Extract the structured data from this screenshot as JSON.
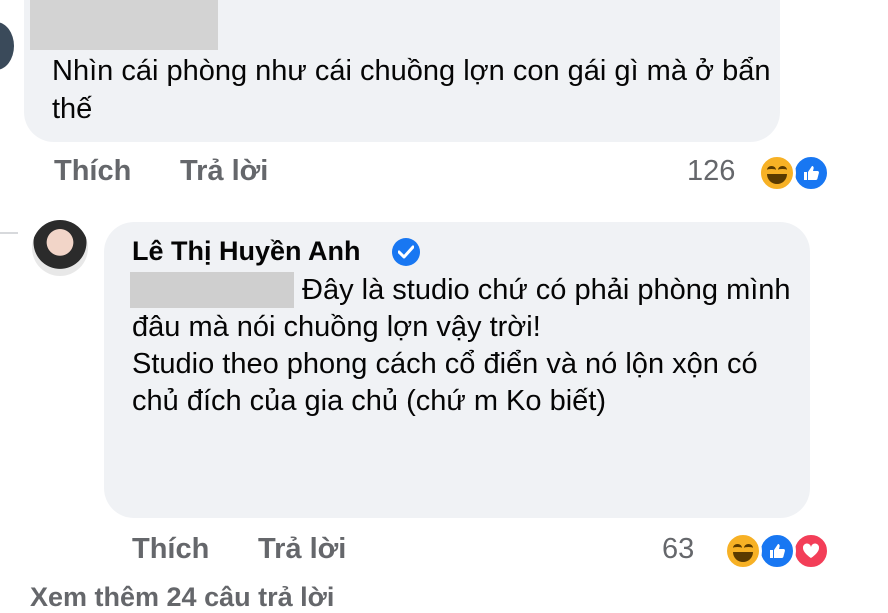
{
  "comment": {
    "text": "Nhìn cái phòng như cái chuồng lợn con gái gì mà ở bẩn thế",
    "actions": {
      "like": "Thích",
      "reply": "Trả lời"
    },
    "reaction_count": "126",
    "reactions": [
      "haha-icon",
      "like-icon"
    ]
  },
  "reply": {
    "author": "Lê Thị Huyền Anh",
    "verified": true,
    "text": "Đây là studio chứ có phải phòng mình đâu mà nói chuồng lợn vậy trời!\nStudio theo phong cách cổ điển và nó lộn xộn có chủ đích của gia chủ (chứ m Ko biết)",
    "actions": {
      "like": "Thích",
      "reply": "Trả lời"
    },
    "reaction_count": "63",
    "reactions": [
      "haha-icon",
      "like-icon",
      "love-icon"
    ]
  },
  "footer": {
    "more_replies": "Xem thêm 24 câu trả lời"
  },
  "colors": {
    "bubble": "#f0f2f5",
    "secondary_text": "#65676b",
    "like_blue": "#1877f2",
    "haha_yellow": "#f7b125",
    "love_red": "#f33e58"
  }
}
